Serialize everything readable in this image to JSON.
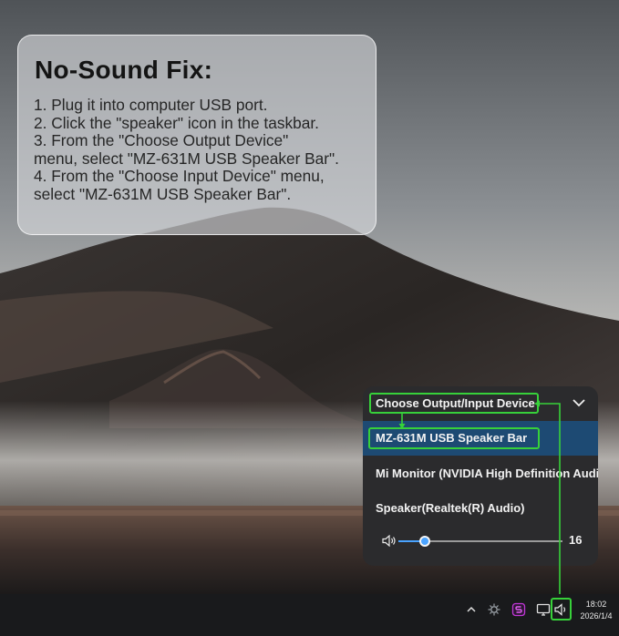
{
  "info_card": {
    "title": "No-Sound Fix:",
    "steps": [
      "1. Plug it into computer USB port.",
      "2. Click the \"speaker\" icon in the taskbar.",
      "3. From the \"Choose Output Device\"\nmenu, select \"MZ-631M USB Speaker Bar\".",
      "4. From the \"Choose Input Device\" menu,\nselect \"MZ-631M USB Speaker Bar\"."
    ]
  },
  "flyout": {
    "title": "Choose Output/Input Device",
    "devices": [
      {
        "label": "MZ-631M USB Speaker Bar",
        "selected": true
      },
      {
        "label": "Mi Monitor (NVIDIA High Definition Audio)",
        "selected": false
      },
      {
        "label": "Speaker(Realtek(R) Audio)",
        "selected": false
      }
    ],
    "volume": {
      "value": "16",
      "level_percent": 16
    }
  },
  "taskbar": {
    "icons": [
      "chevron-up-icon",
      "network-icon",
      "app-s-icon",
      "monitor-icon",
      "speaker-icon"
    ],
    "time": "18:02",
    "date": "2026/1/4"
  },
  "colors": {
    "highlight_green": "#37d13a",
    "selected_row": "#1d4a73",
    "flyout_bg": "#2b2b2d",
    "accent_blue": "#4aa3ff",
    "taskbar_bg": "#191a1c"
  }
}
